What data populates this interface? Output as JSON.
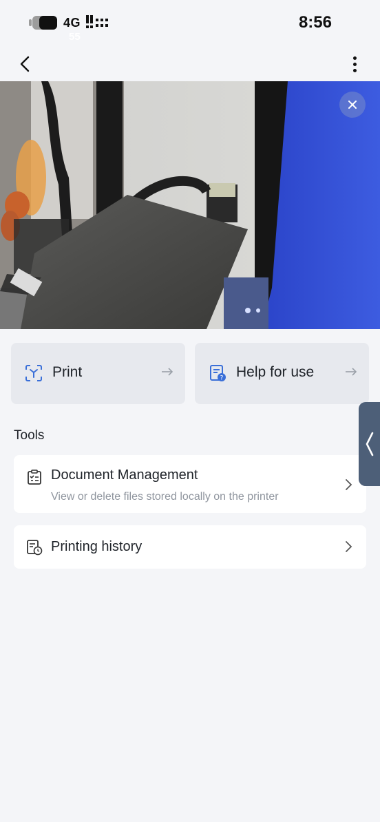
{
  "status_bar": {
    "battery_level": "55",
    "network": "4G",
    "time": "8:56"
  },
  "nav": {
    "back_icon": "chevron-left-icon",
    "more_icon": "vertical-dots-icon"
  },
  "camera": {
    "close_icon": "close-icon"
  },
  "actions": [
    {
      "label": "Print",
      "icon": "scan-print-icon",
      "arrow": "arrow-right-icon",
      "accent": "#3a6fd8"
    },
    {
      "label": "Help for use",
      "icon": "help-document-icon",
      "arrow": "arrow-right-icon",
      "accent": "#3a6fd8"
    }
  ],
  "tools": {
    "title": "Tools",
    "items": [
      {
        "title": "Document Management",
        "description": "View or delete files stored locally on the printer",
        "icon": "clipboard-list-icon"
      },
      {
        "title": "Printing history",
        "icon": "history-document-icon"
      }
    ]
  },
  "colors": {
    "background": "#f4f5f8",
    "card": "#ffffff",
    "action_card": "#e7e9ee",
    "accent": "#3a6fd8",
    "side_handle": "#4d5f78"
  }
}
